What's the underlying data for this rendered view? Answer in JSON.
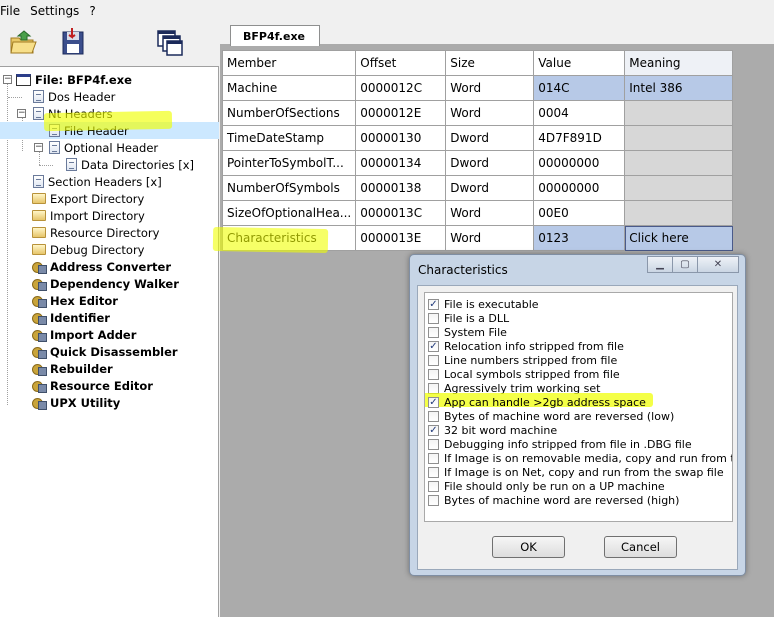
{
  "menu": [
    "File",
    "Settings",
    "?"
  ],
  "tab": {
    "label": "BFP4f.exe"
  },
  "tree": {
    "root": "File: BFP4f.exe",
    "items": [
      {
        "label": "Dos Header",
        "icon": "doc-icon",
        "bold": false
      },
      {
        "label": "Nt Headers",
        "icon": "doc-icon",
        "bold": false
      },
      {
        "label": "File Header",
        "icon": "doc-icon",
        "bold": false
      },
      {
        "label": "Optional Header",
        "icon": "doc-icon",
        "bold": false
      },
      {
        "label": "Data Directories [x]",
        "icon": "doc-icon",
        "bold": false
      },
      {
        "label": "Section Headers [x]",
        "icon": "doc-icon",
        "bold": false
      },
      {
        "label": "Export Directory",
        "icon": "folder-icon",
        "bold": false
      },
      {
        "label": "Import Directory",
        "icon": "folder-icon",
        "bold": false
      },
      {
        "label": "Resource Directory",
        "icon": "folder-icon",
        "bold": false
      },
      {
        "label": "Debug Directory",
        "icon": "folder-icon",
        "bold": false
      },
      {
        "label": "Address Converter",
        "icon": "tool-icon",
        "bold": true
      },
      {
        "label": "Dependency Walker",
        "icon": "tool-icon",
        "bold": true
      },
      {
        "label": "Hex Editor",
        "icon": "tool-icon",
        "bold": true
      },
      {
        "label": "Identifier",
        "icon": "tool-icon",
        "bold": true
      },
      {
        "label": "Import Adder",
        "icon": "tool-icon",
        "bold": true
      },
      {
        "label": "Quick Disassembler",
        "icon": "tool-icon",
        "bold": true
      },
      {
        "label": "Rebuilder",
        "icon": "tool-icon",
        "bold": true
      },
      {
        "label": "Resource Editor",
        "icon": "tool-icon",
        "bold": true
      },
      {
        "label": "UPX Utility",
        "icon": "tool-icon",
        "bold": true
      }
    ]
  },
  "grid": {
    "headers": [
      "Member",
      "Offset",
      "Size",
      "Value",
      "Meaning"
    ],
    "rows": [
      [
        "Machine",
        "0000012C",
        "Word",
        "014C",
        "Intel 386"
      ],
      [
        "NumberOfSections",
        "0000012E",
        "Word",
        "0004",
        ""
      ],
      [
        "TimeDateStamp",
        "00000130",
        "Dword",
        "4D7F891D",
        ""
      ],
      [
        "PointerToSymbolT...",
        "00000134",
        "Dword",
        "00000000",
        ""
      ],
      [
        "NumberOfSymbols",
        "00000138",
        "Dword",
        "00000000",
        ""
      ],
      [
        "SizeOfOptionalHea...",
        "0000013C",
        "Word",
        "00E0",
        ""
      ],
      [
        "Characteristics",
        "0000013E",
        "Word",
        "0123",
        "Click here"
      ]
    ]
  },
  "dialog": {
    "title": "Characteristics",
    "ok_label": "OK",
    "cancel_label": "Cancel",
    "flags": [
      {
        "label": "File is executable",
        "checked": true
      },
      {
        "label": "File is a DLL",
        "checked": false
      },
      {
        "label": "System File",
        "checked": false
      },
      {
        "label": "Relocation info stripped from file",
        "checked": true
      },
      {
        "label": "Line numbers stripped from file",
        "checked": false
      },
      {
        "label": "Local symbols stripped from file",
        "checked": false
      },
      {
        "label": "Agressively trim working set",
        "checked": false
      },
      {
        "label": "App can handle >2gb address space",
        "checked": true
      },
      {
        "label": "Bytes of machine word are reversed (low)",
        "checked": false
      },
      {
        "label": "32 bit word machine",
        "checked": true
      },
      {
        "label": "Debugging info stripped from file in .DBG file",
        "checked": false
      },
      {
        "label": "If Image is on removable media, copy and run from the swap file",
        "checked": false
      },
      {
        "label": "If Image is on Net, copy and run from the swap file",
        "checked": false
      },
      {
        "label": "File should only be run on a UP machine",
        "checked": false
      },
      {
        "label": "Bytes of machine word are reversed (high)",
        "checked": false
      }
    ]
  }
}
